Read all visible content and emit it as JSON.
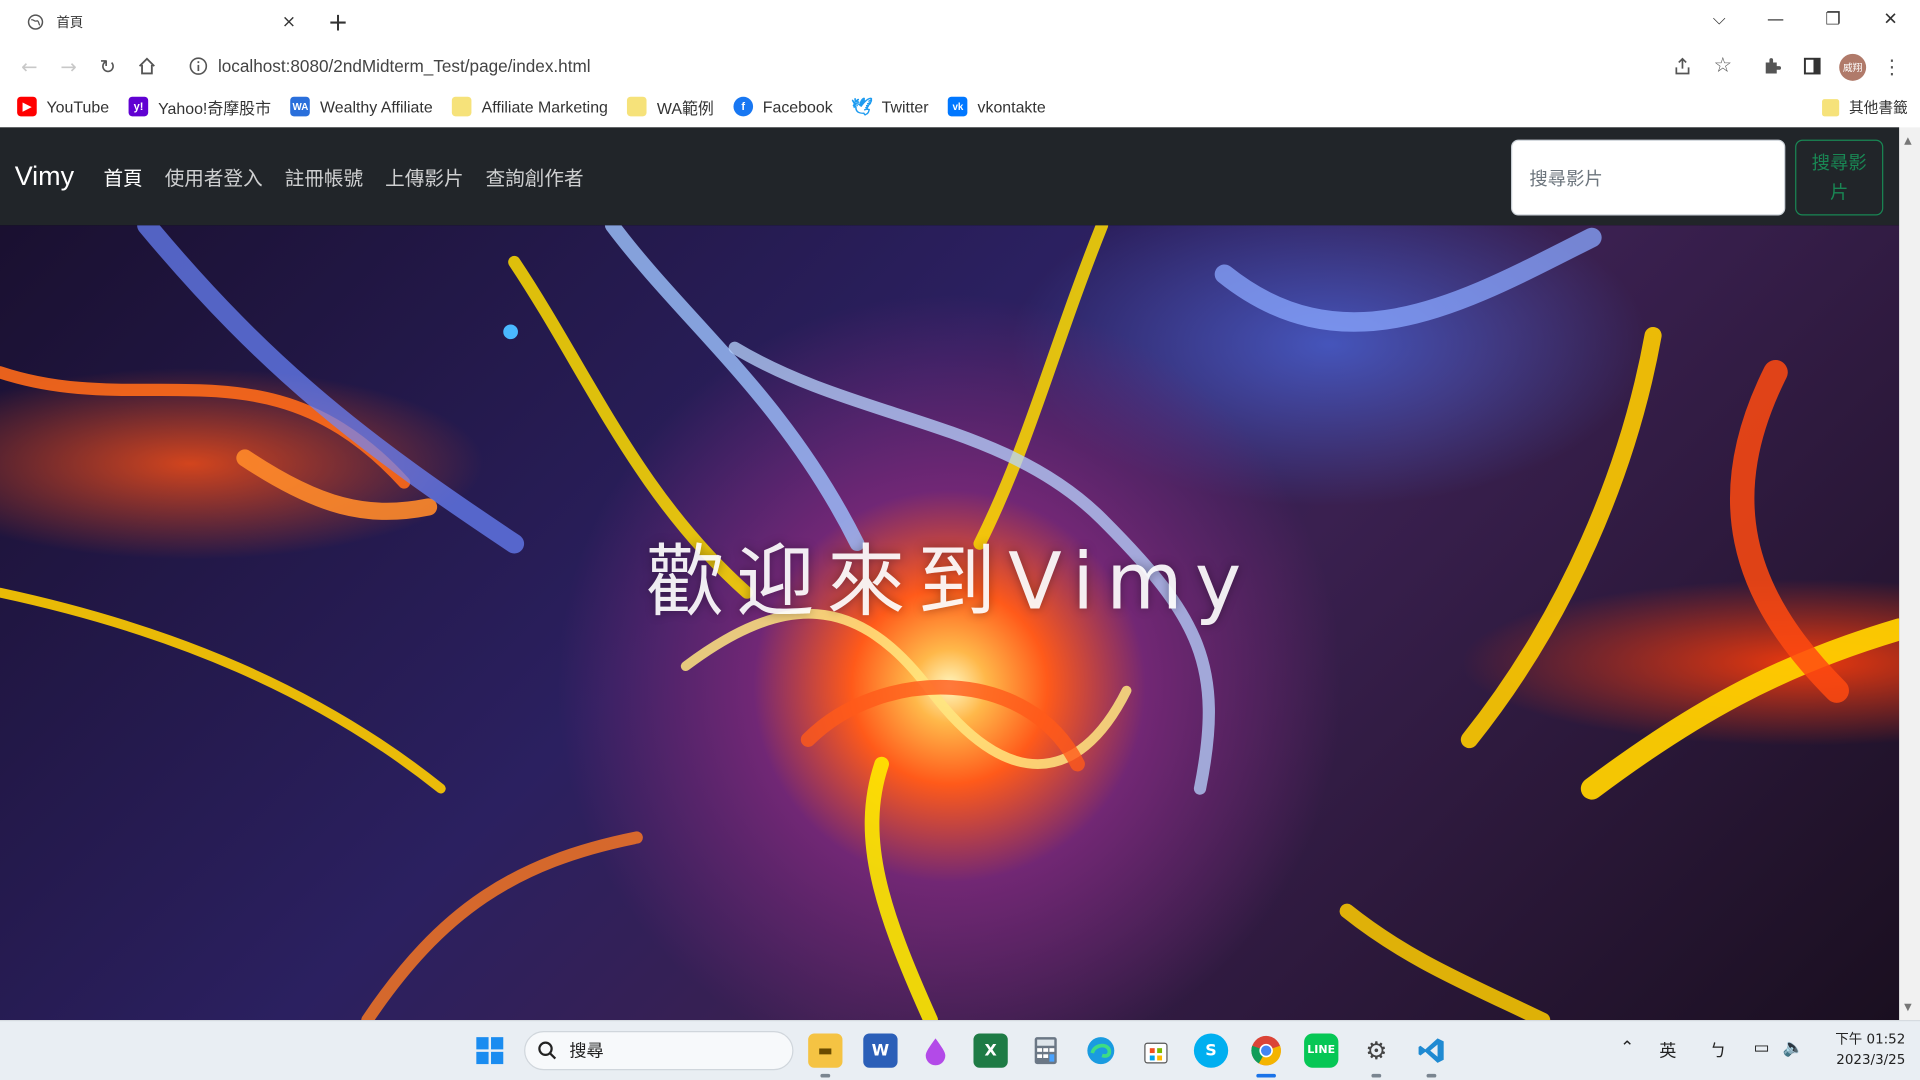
{
  "browser": {
    "tab_title": "首頁",
    "tab_close": "×",
    "new_tab": "+",
    "url": "localhost:8080/2ndMidterm_Test/page/index.html",
    "profile_label": "威翔",
    "controls": {
      "dropdown": "⌵",
      "minimize": "—",
      "restore": "❐",
      "close": "✕"
    }
  },
  "bookmarks": {
    "items": [
      {
        "label": "YouTube",
        "icon": "youtube-icon",
        "color": "#ff0000",
        "glyph": "▶"
      },
      {
        "label": "Yahoo!奇摩股市",
        "icon": "yahoo-icon",
        "color": "#6001d2",
        "glyph": "y!"
      },
      {
        "label": "Wealthy Affiliate",
        "icon": "wa-icon",
        "color": "#2a6fdb",
        "glyph": "WA"
      },
      {
        "label": "Affiliate Marketing",
        "icon": "folder-icon",
        "color": "#f6e27a",
        "glyph": ""
      },
      {
        "label": "WA範例",
        "icon": "folder-icon",
        "color": "#f6e27a",
        "glyph": ""
      },
      {
        "label": "Facebook",
        "icon": "facebook-icon",
        "color": "#1877f2",
        "glyph": "f"
      },
      {
        "label": "Twitter",
        "icon": "twitter-icon",
        "color": "#1d9bf0",
        "glyph": "t"
      },
      {
        "label": "vkontakte",
        "icon": "vk-icon",
        "color": "#0077ff",
        "glyph": "vk"
      }
    ],
    "other": "其他書籤"
  },
  "site": {
    "brand": "Vimy",
    "nav": [
      "首頁",
      "使用者登入",
      "註冊帳號",
      "上傳影片",
      "查詢創作者"
    ],
    "search_placeholder": "搜尋影片",
    "search_button": "搜尋影片",
    "hero_title": "歡迎來到Vimy",
    "accent": "#198754",
    "navbar_bg": "#212529"
  },
  "taskbar": {
    "search_label": "搜尋",
    "ime": "英",
    "time": "下午 01:52",
    "date": "2023/3/25"
  }
}
